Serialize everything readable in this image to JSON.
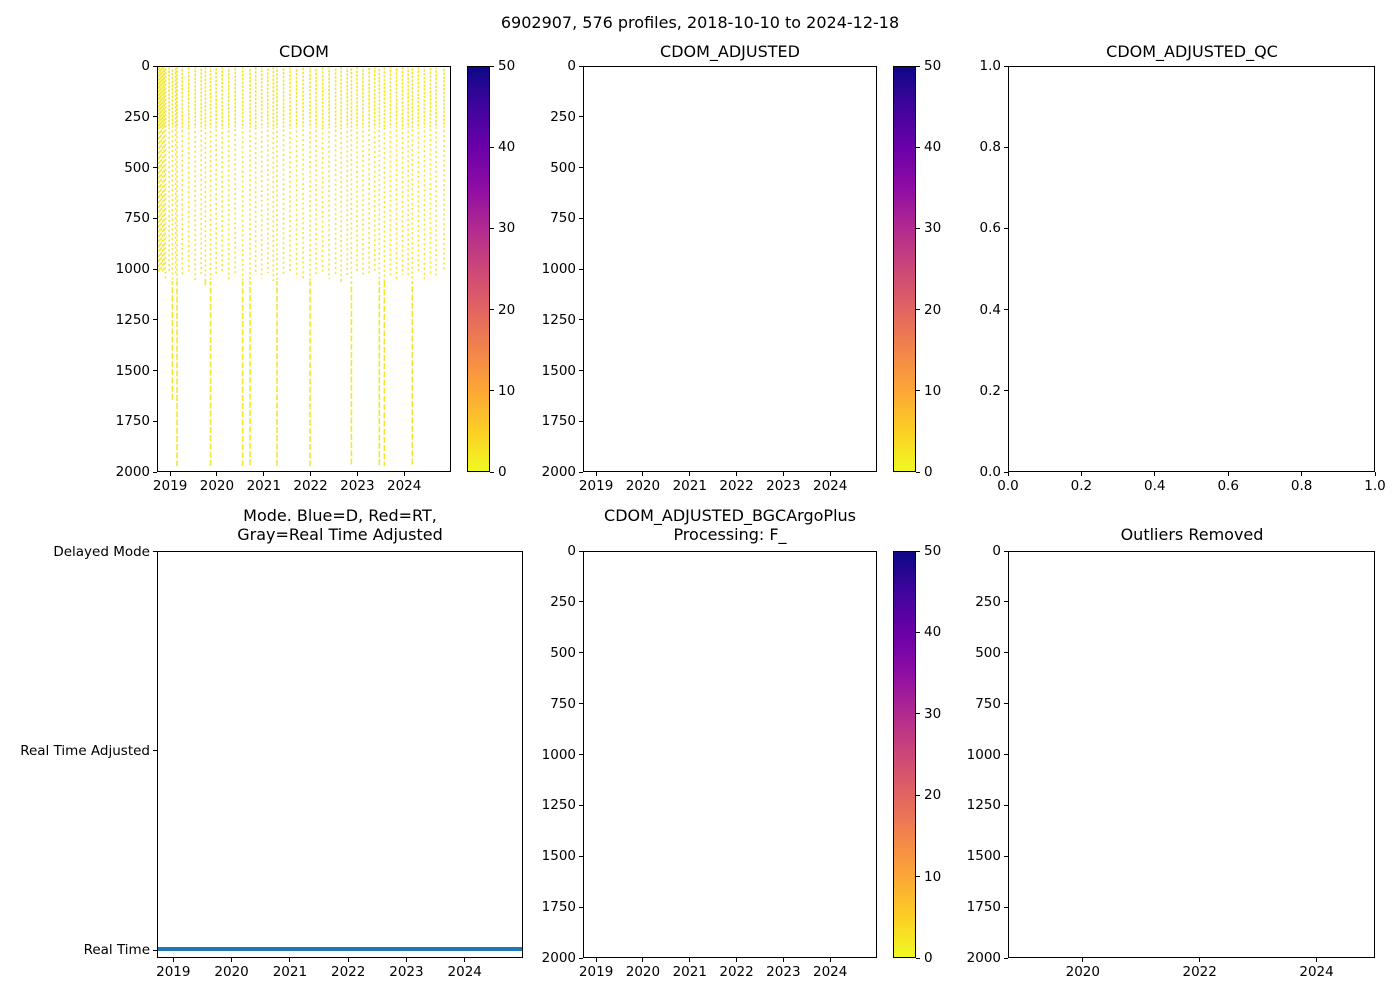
{
  "suptitle": "6902907, 576 profiles, 2018-10-10 to 2024-12-18",
  "colors": {
    "background": "#ffffff",
    "axis": "#000000",
    "text": "#000000",
    "profile_marker": "#f1e72c",
    "mode_line": "#1f77b4"
  },
  "colorbar": {
    "ticks": [
      {
        "label": "0",
        "f": 0.0
      },
      {
        "label": "10",
        "f": 0.2
      },
      {
        "label": "20",
        "f": 0.4
      },
      {
        "label": "30",
        "f": 0.6
      },
      {
        "label": "40",
        "f": 0.8
      },
      {
        "label": "50",
        "f": 1.0
      }
    ],
    "gradient_bottom_to_top": [
      "#f0f921",
      "#fcce25",
      "#fca636",
      "#f2844b",
      "#e16462",
      "#cc4778",
      "#b12a90",
      "#8f0da4",
      "#6a00a8",
      "#41049d",
      "#0d0887"
    ]
  },
  "subplots": {
    "ax1": {
      "title": "CDOM",
      "xticks": [
        {
          "label": "2019",
          "f": 0.0446
        },
        {
          "label": "2020",
          "f": 0.2038
        },
        {
          "label": "2021",
          "f": 0.3631
        },
        {
          "label": "2022",
          "f": 0.5223
        },
        {
          "label": "2023",
          "f": 0.6815
        },
        {
          "label": "2024",
          "f": 0.8408
        }
      ],
      "yticks": [
        {
          "label": "0",
          "f": 0
        },
        {
          "label": "250",
          "f": 0.125
        },
        {
          "label": "500",
          "f": 0.25
        },
        {
          "label": "750",
          "f": 0.375
        },
        {
          "label": "1000",
          "f": 0.5
        },
        {
          "label": "1250",
          "f": 0.625
        },
        {
          "label": "1500",
          "f": 0.75
        },
        {
          "label": "1750",
          "f": 0.875
        },
        {
          "label": "2000",
          "f": 1
        }
      ]
    },
    "ax2": {
      "title": "CDOM_ADJUSTED",
      "xticks": [
        {
          "label": "2019",
          "f": 0.0446
        },
        {
          "label": "2020",
          "f": 0.2038
        },
        {
          "label": "2021",
          "f": 0.3631
        },
        {
          "label": "2022",
          "f": 0.5223
        },
        {
          "label": "2023",
          "f": 0.6815
        },
        {
          "label": "2024",
          "f": 0.8408
        }
      ],
      "yticks": [
        {
          "label": "0",
          "f": 0
        },
        {
          "label": "250",
          "f": 0.125
        },
        {
          "label": "500",
          "f": 0.25
        },
        {
          "label": "750",
          "f": 0.375
        },
        {
          "label": "1000",
          "f": 0.5
        },
        {
          "label": "1250",
          "f": 0.625
        },
        {
          "label": "1500",
          "f": 0.75
        },
        {
          "label": "1750",
          "f": 0.875
        },
        {
          "label": "2000",
          "f": 1
        }
      ]
    },
    "ax3": {
      "title": "CDOM_ADJUSTED_QC",
      "xticks": [
        {
          "label": "0.0",
          "f": 0
        },
        {
          "label": "0.2",
          "f": 0.2
        },
        {
          "label": "0.4",
          "f": 0.4
        },
        {
          "label": "0.6",
          "f": 0.6
        },
        {
          "label": "0.8",
          "f": 0.8
        },
        {
          "label": "1.0",
          "f": 1
        }
      ],
      "yticks": [
        {
          "label": "1.0",
          "f": 0
        },
        {
          "label": "0.8",
          "f": 0.2
        },
        {
          "label": "0.6",
          "f": 0.4
        },
        {
          "label": "0.4",
          "f": 0.6
        },
        {
          "label": "0.2",
          "f": 0.8
        },
        {
          "label": "0.0",
          "f": 1
        }
      ]
    },
    "ax4": {
      "title": "Mode. Blue=D, Red=RT,\nGray=Real Time Adjusted",
      "xticks": [
        {
          "label": "2019",
          "f": 0.0446
        },
        {
          "label": "2020",
          "f": 0.2038
        },
        {
          "label": "2021",
          "f": 0.3631
        },
        {
          "label": "2022",
          "f": 0.5223
        },
        {
          "label": "2023",
          "f": 0.6815
        },
        {
          "label": "2024",
          "f": 0.8408
        }
      ],
      "yticks": [
        {
          "label": "Delayed Mode",
          "f": 0.002
        },
        {
          "label": "Real Time Adjusted",
          "f": 0.491
        },
        {
          "label": "Real Time",
          "f": 0.981
        }
      ]
    },
    "ax5": {
      "title": "CDOM_ADJUSTED_BGCArgoPlus\nProcessing: F_",
      "xticks": [
        {
          "label": "2019",
          "f": 0.0446
        },
        {
          "label": "2020",
          "f": 0.2038
        },
        {
          "label": "2021",
          "f": 0.3631
        },
        {
          "label": "2022",
          "f": 0.5223
        },
        {
          "label": "2023",
          "f": 0.6815
        },
        {
          "label": "2024",
          "f": 0.8408
        }
      ],
      "yticks": [
        {
          "label": "0",
          "f": 0
        },
        {
          "label": "250",
          "f": 0.125
        },
        {
          "label": "500",
          "f": 0.25
        },
        {
          "label": "750",
          "f": 0.375
        },
        {
          "label": "1000",
          "f": 0.5
        },
        {
          "label": "1250",
          "f": 0.625
        },
        {
          "label": "1500",
          "f": 0.75
        },
        {
          "label": "1750",
          "f": 0.875
        },
        {
          "label": "2000",
          "f": 1
        }
      ]
    },
    "ax6": {
      "title": "Outliers Removed",
      "xticks": [
        {
          "label": "2020",
          "f": 0.2038
        },
        {
          "label": "2022",
          "f": 0.5223
        },
        {
          "label": "2024",
          "f": 0.8408
        }
      ],
      "yticks": [
        {
          "label": "0",
          "f": 0
        },
        {
          "label": "250",
          "f": 0.125
        },
        {
          "label": "500",
          "f": 0.25
        },
        {
          "label": "750",
          "f": 0.375
        },
        {
          "label": "1000",
          "f": 0.5
        },
        {
          "label": "1250",
          "f": 0.625
        },
        {
          "label": "1500",
          "f": 0.75
        },
        {
          "label": "1750",
          "f": 0.875
        },
        {
          "label": "2000",
          "f": 1
        }
      ]
    }
  },
  "chart_data": [
    {
      "id": "ax1",
      "type": "scatter",
      "title": "CDOM",
      "x_range_years": [
        2018.72,
        2025.0
      ],
      "y_range_m": [
        0,
        2000
      ],
      "y_inverted": true,
      "colorbar_range": [
        0,
        50
      ],
      "marker_value_color": "#f0f921",
      "profiles_year_maxdepth": [
        [
          2018.73,
          1015
        ],
        [
          2018.76,
          1020
        ],
        [
          2018.79,
          1010
        ],
        [
          2018.82,
          1025
        ],
        [
          2018.85,
          1015
        ],
        [
          2018.88,
          1050
        ],
        [
          2018.96,
          1020
        ],
        [
          2019.03,
          1650
        ],
        [
          2019.1,
          1030
        ],
        [
          2019.13,
          1975
        ],
        [
          2019.24,
          1040
        ],
        [
          2019.38,
          1020
        ],
        [
          2019.52,
          1060
        ],
        [
          2019.65,
          1025
        ],
        [
          2019.74,
          1080
        ],
        [
          2019.85,
          1975
        ],
        [
          2019.97,
          1030
        ],
        [
          2020.1,
          1020
        ],
        [
          2020.24,
          1060
        ],
        [
          2020.38,
          1025
        ],
        [
          2020.54,
          1975
        ],
        [
          2020.7,
          1975
        ],
        [
          2020.82,
          1030
        ],
        [
          2020.95,
          1050
        ],
        [
          2021.08,
          1020
        ],
        [
          2021.2,
          1060
        ],
        [
          2021.28,
          1975
        ],
        [
          2021.42,
          1030
        ],
        [
          2021.56,
          1020
        ],
        [
          2021.7,
          1045
        ],
        [
          2021.84,
          1060
        ],
        [
          2021.99,
          1975
        ],
        [
          2022.12,
          1030
        ],
        [
          2022.26,
          1020
        ],
        [
          2022.4,
          1050
        ],
        [
          2022.54,
          1030
        ],
        [
          2022.66,
          1065
        ],
        [
          2022.79,
          1030
        ],
        [
          2022.88,
          1975
        ],
        [
          2023.0,
          1020
        ],
        [
          2023.13,
          1040
        ],
        [
          2023.26,
          1030
        ],
        [
          2023.38,
          1020
        ],
        [
          2023.48,
          1975
        ],
        [
          2023.59,
          1975
        ],
        [
          2023.72,
          1030
        ],
        [
          2023.85,
          1050
        ],
        [
          2023.98,
          1030
        ],
        [
          2024.1,
          1040
        ],
        [
          2024.19,
          1975
        ],
        [
          2024.32,
          1020
        ],
        [
          2024.45,
          1050
        ],
        [
          2024.58,
          1030
        ],
        [
          2024.7,
          1040
        ],
        [
          2024.87,
          1015
        ]
      ]
    },
    {
      "id": "ax2",
      "type": "scatter",
      "title": "CDOM_ADJUSTED",
      "x_range_years": [
        2018.72,
        2025.0
      ],
      "y_range_m": [
        0,
        2000
      ],
      "y_inverted": true,
      "colorbar_range": [
        0,
        50
      ],
      "profiles_year_maxdepth": []
    },
    {
      "id": "ax3",
      "type": "scatter",
      "title": "CDOM_ADJUSTED_QC",
      "x_range": [
        0.0,
        1.0
      ],
      "y_range": [
        0.0,
        1.0
      ],
      "points": []
    },
    {
      "id": "ax4",
      "type": "scatter",
      "title": "Mode. Blue=D, Red=RT,\nGray=Real Time Adjusted",
      "categories": [
        "Delayed Mode",
        "Real Time Adjusted",
        "Real Time"
      ],
      "series": [
        {
          "name": "Real Time",
          "category": "Real Time",
          "color": "#1f77b4",
          "year_start": 2018.78,
          "year_end": 2024.96
        }
      ]
    },
    {
      "id": "ax5",
      "type": "scatter",
      "title": "CDOM_ADJUSTED_BGCArgoPlus\nProcessing: F_",
      "x_range_years": [
        2018.72,
        2025.0
      ],
      "y_range_m": [
        0,
        2000
      ],
      "y_inverted": true,
      "colorbar_range": [
        0,
        50
      ],
      "profiles_year_maxdepth": []
    },
    {
      "id": "ax6",
      "type": "scatter",
      "title": "Outliers Removed",
      "x_range_years": [
        2018.72,
        2025.0
      ],
      "y_range_m": [
        0,
        2000
      ],
      "y_inverted": true,
      "points": []
    }
  ]
}
